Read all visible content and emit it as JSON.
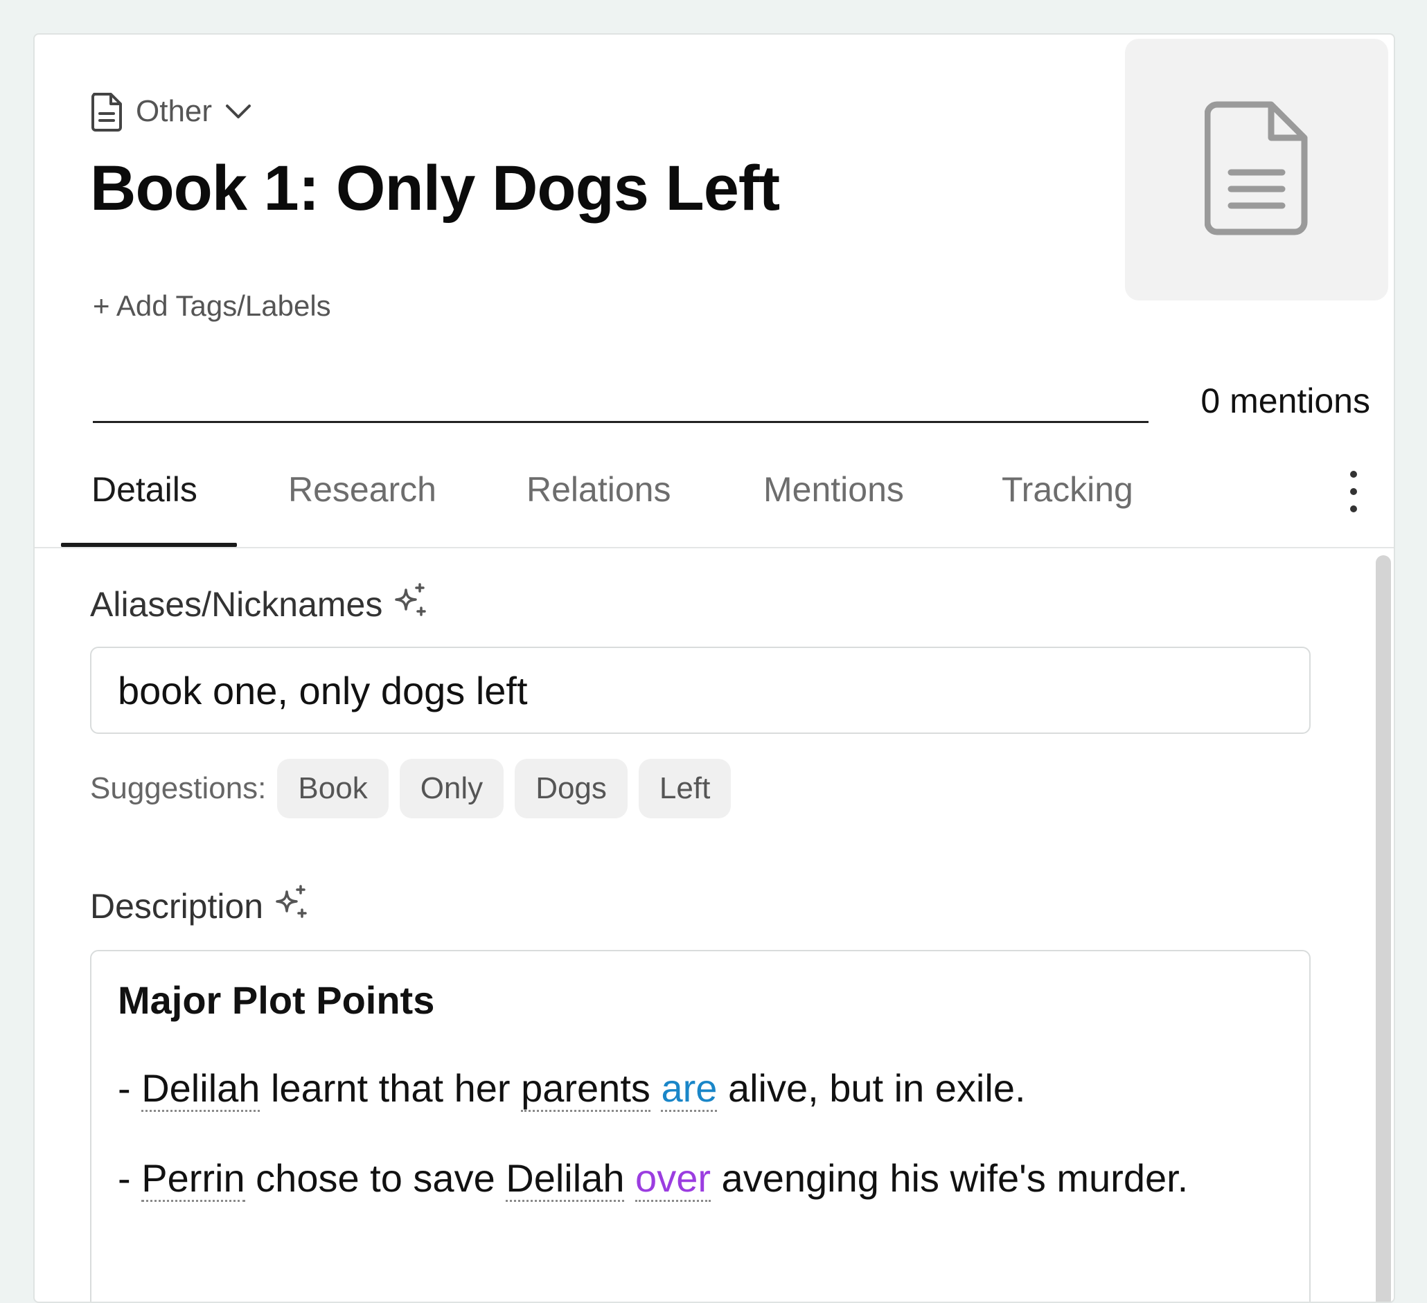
{
  "header": {
    "type_label": "Other",
    "title": "Book 1: Only Dogs Left",
    "add_tags_label": "+ Add Tags/Labels",
    "mentions_count": "0 mentions"
  },
  "tabs": [
    {
      "label": "Details",
      "active": true
    },
    {
      "label": "Research",
      "active": false
    },
    {
      "label": "Relations",
      "active": false
    },
    {
      "label": "Mentions",
      "active": false
    },
    {
      "label": "Tracking",
      "active": false
    }
  ],
  "aliases": {
    "label": "Aliases/Nicknames",
    "value": "book one, only dogs left",
    "suggestions_label": "Suggestions:",
    "suggestions": [
      "Book",
      "Only",
      "Dogs",
      "Left"
    ]
  },
  "description": {
    "label": "Description",
    "heading": "Major Plot Points",
    "line1": {
      "dash": "- ",
      "w1": "Delilah",
      "t1": " learnt that her ",
      "w2": "parents",
      "t2": " ",
      "w3": "are",
      "t3": " alive, but in exile."
    },
    "line2": {
      "dash": "- ",
      "w1": "Perrin",
      "t1": " chose to save ",
      "w2": "Delilah",
      "t2": " ",
      "w3": "over",
      "t3": " avenging his wife's murder."
    }
  },
  "colors": {
    "accent_blue": "#1a86c8",
    "accent_purple": "#9b3de0",
    "background": "#eef3f2"
  },
  "icons": [
    "document-icon",
    "chevron-down-icon",
    "sparkle-icon",
    "kebab-menu-icon"
  ]
}
